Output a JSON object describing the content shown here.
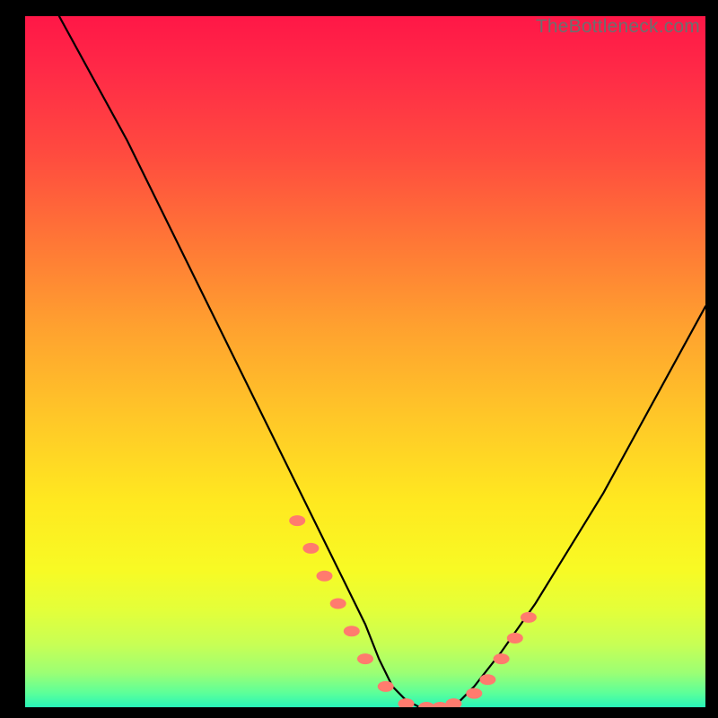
{
  "watermark": "TheBottleneck.com",
  "chart_data": {
    "type": "line",
    "title": "",
    "xlabel": "",
    "ylabel": "",
    "xlim": [
      0,
      100
    ],
    "ylim": [
      0,
      100
    ],
    "grid": false,
    "legend": false,
    "notes": "V-shaped curve on a vertical rainbow gradient; curve reaches ~0 near x≈55–60 and rises on both sides. Small salmon dot markers highlight points along the lower part of both branches and along the flat bottom.",
    "series": [
      {
        "name": "curve",
        "x": [
          5,
          10,
          15,
          20,
          25,
          30,
          35,
          40,
          45,
          50,
          52,
          54,
          56,
          58,
          60,
          62,
          64,
          66,
          70,
          75,
          80,
          85,
          90,
          95,
          100
        ],
        "y": [
          100,
          91,
          82,
          72,
          62,
          52,
          42,
          32,
          22,
          12,
          7,
          3,
          1,
          0,
          0,
          0,
          1,
          3,
          8,
          15,
          23,
          31,
          40,
          49,
          58
        ]
      },
      {
        "name": "highlight-dots",
        "x": [
          40,
          42,
          44,
          46,
          48,
          50,
          53,
          56,
          59,
          61,
          63,
          66,
          68,
          70,
          72,
          74
        ],
        "y": [
          27,
          23,
          19,
          15,
          11,
          7,
          3,
          0.5,
          0,
          0,
          0.5,
          2,
          4,
          7,
          10,
          13
        ]
      }
    ]
  }
}
